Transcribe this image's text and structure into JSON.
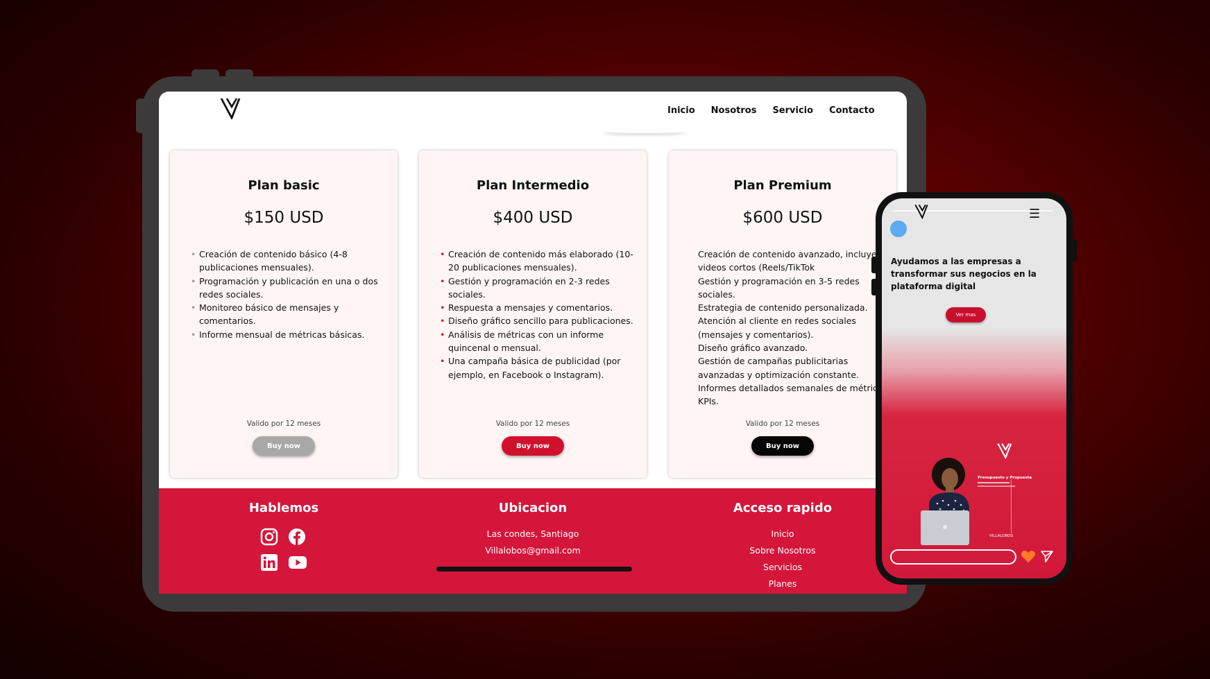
{
  "colors": {
    "accent": "#d4163a",
    "basic_button": "#a8a8a8",
    "inter_button": "#d0102c",
    "premium_button": "#050505",
    "background": "#5a0000"
  },
  "nav": {
    "links": [
      "Inicio",
      "Nosotros",
      "Servicio",
      "Contacto"
    ]
  },
  "plans": [
    {
      "title": "Plan basic",
      "price": "$150 USD",
      "features": [
        "Creación de contenido básico (4-8 publicaciones mensuales).",
        "Programación y publicación en una o dos redes sociales.",
        "Monitoreo básico de mensajes y comentarios.",
        "Informe mensual de métricas básicas."
      ],
      "validity": "Valido por 12 meses",
      "button": "Buy now"
    },
    {
      "title": "Plan Intermedio",
      "price": "$400 USD",
      "features": [
        "Creación de contenido más elaborado (10-20 publicaciones mensuales).",
        "Gestión y programación en 2-3 redes sociales.",
        "Respuesta a mensajes y comentarios.",
        "Diseño gráfico sencillo para publicaciones.",
        "Análisis de métricas con un informe quincenal o mensual.",
        "Una campaña básica de publicidad (por ejemplo, en Facebook o Instagram)."
      ],
      "validity": "Valido por 12 meses",
      "button": "Buy now"
    },
    {
      "title": "Plan Premium",
      "price": "$600 USD",
      "features": [
        "Creación de contenido avanzado, incluyendo videos cortos (Reels/TikTok",
        "Gestión y programación en 3-5 redes sociales.",
        "Estrategia de contenido personalizada.",
        "Atención al cliente en redes sociales (mensajes y comentarios).",
        "Diseño gráfico avanzado.",
        "Gestión de campañas publicitarias avanzadas y optimización constante.",
        "Informes detallados semanales de métricas y KPIs."
      ],
      "validity": "Valido por 12 meses",
      "button": "Buy now"
    }
  ],
  "footer": {
    "contact_title": "Hablemos",
    "location_title": "Ubicacion",
    "location_lines": [
      "Las condes, Santiago",
      "Villalobos@gmail.com"
    ],
    "quick_title": "Acceso rapido",
    "quick_links": [
      "Inicio",
      "Sobre Nosotros",
      "Servicios",
      "Planes"
    ],
    "social_icons": [
      "instagram-icon",
      "facebook-icon",
      "linkedin-icon",
      "youtube-icon"
    ]
  },
  "phone": {
    "headline": "Ayudamos a las empresas a transformar sus negocios en la plataforma digital",
    "cta": "Ver mas",
    "promo_title": "Presupuesto y Propuesta",
    "brand_small": "VILLALOBOS"
  }
}
